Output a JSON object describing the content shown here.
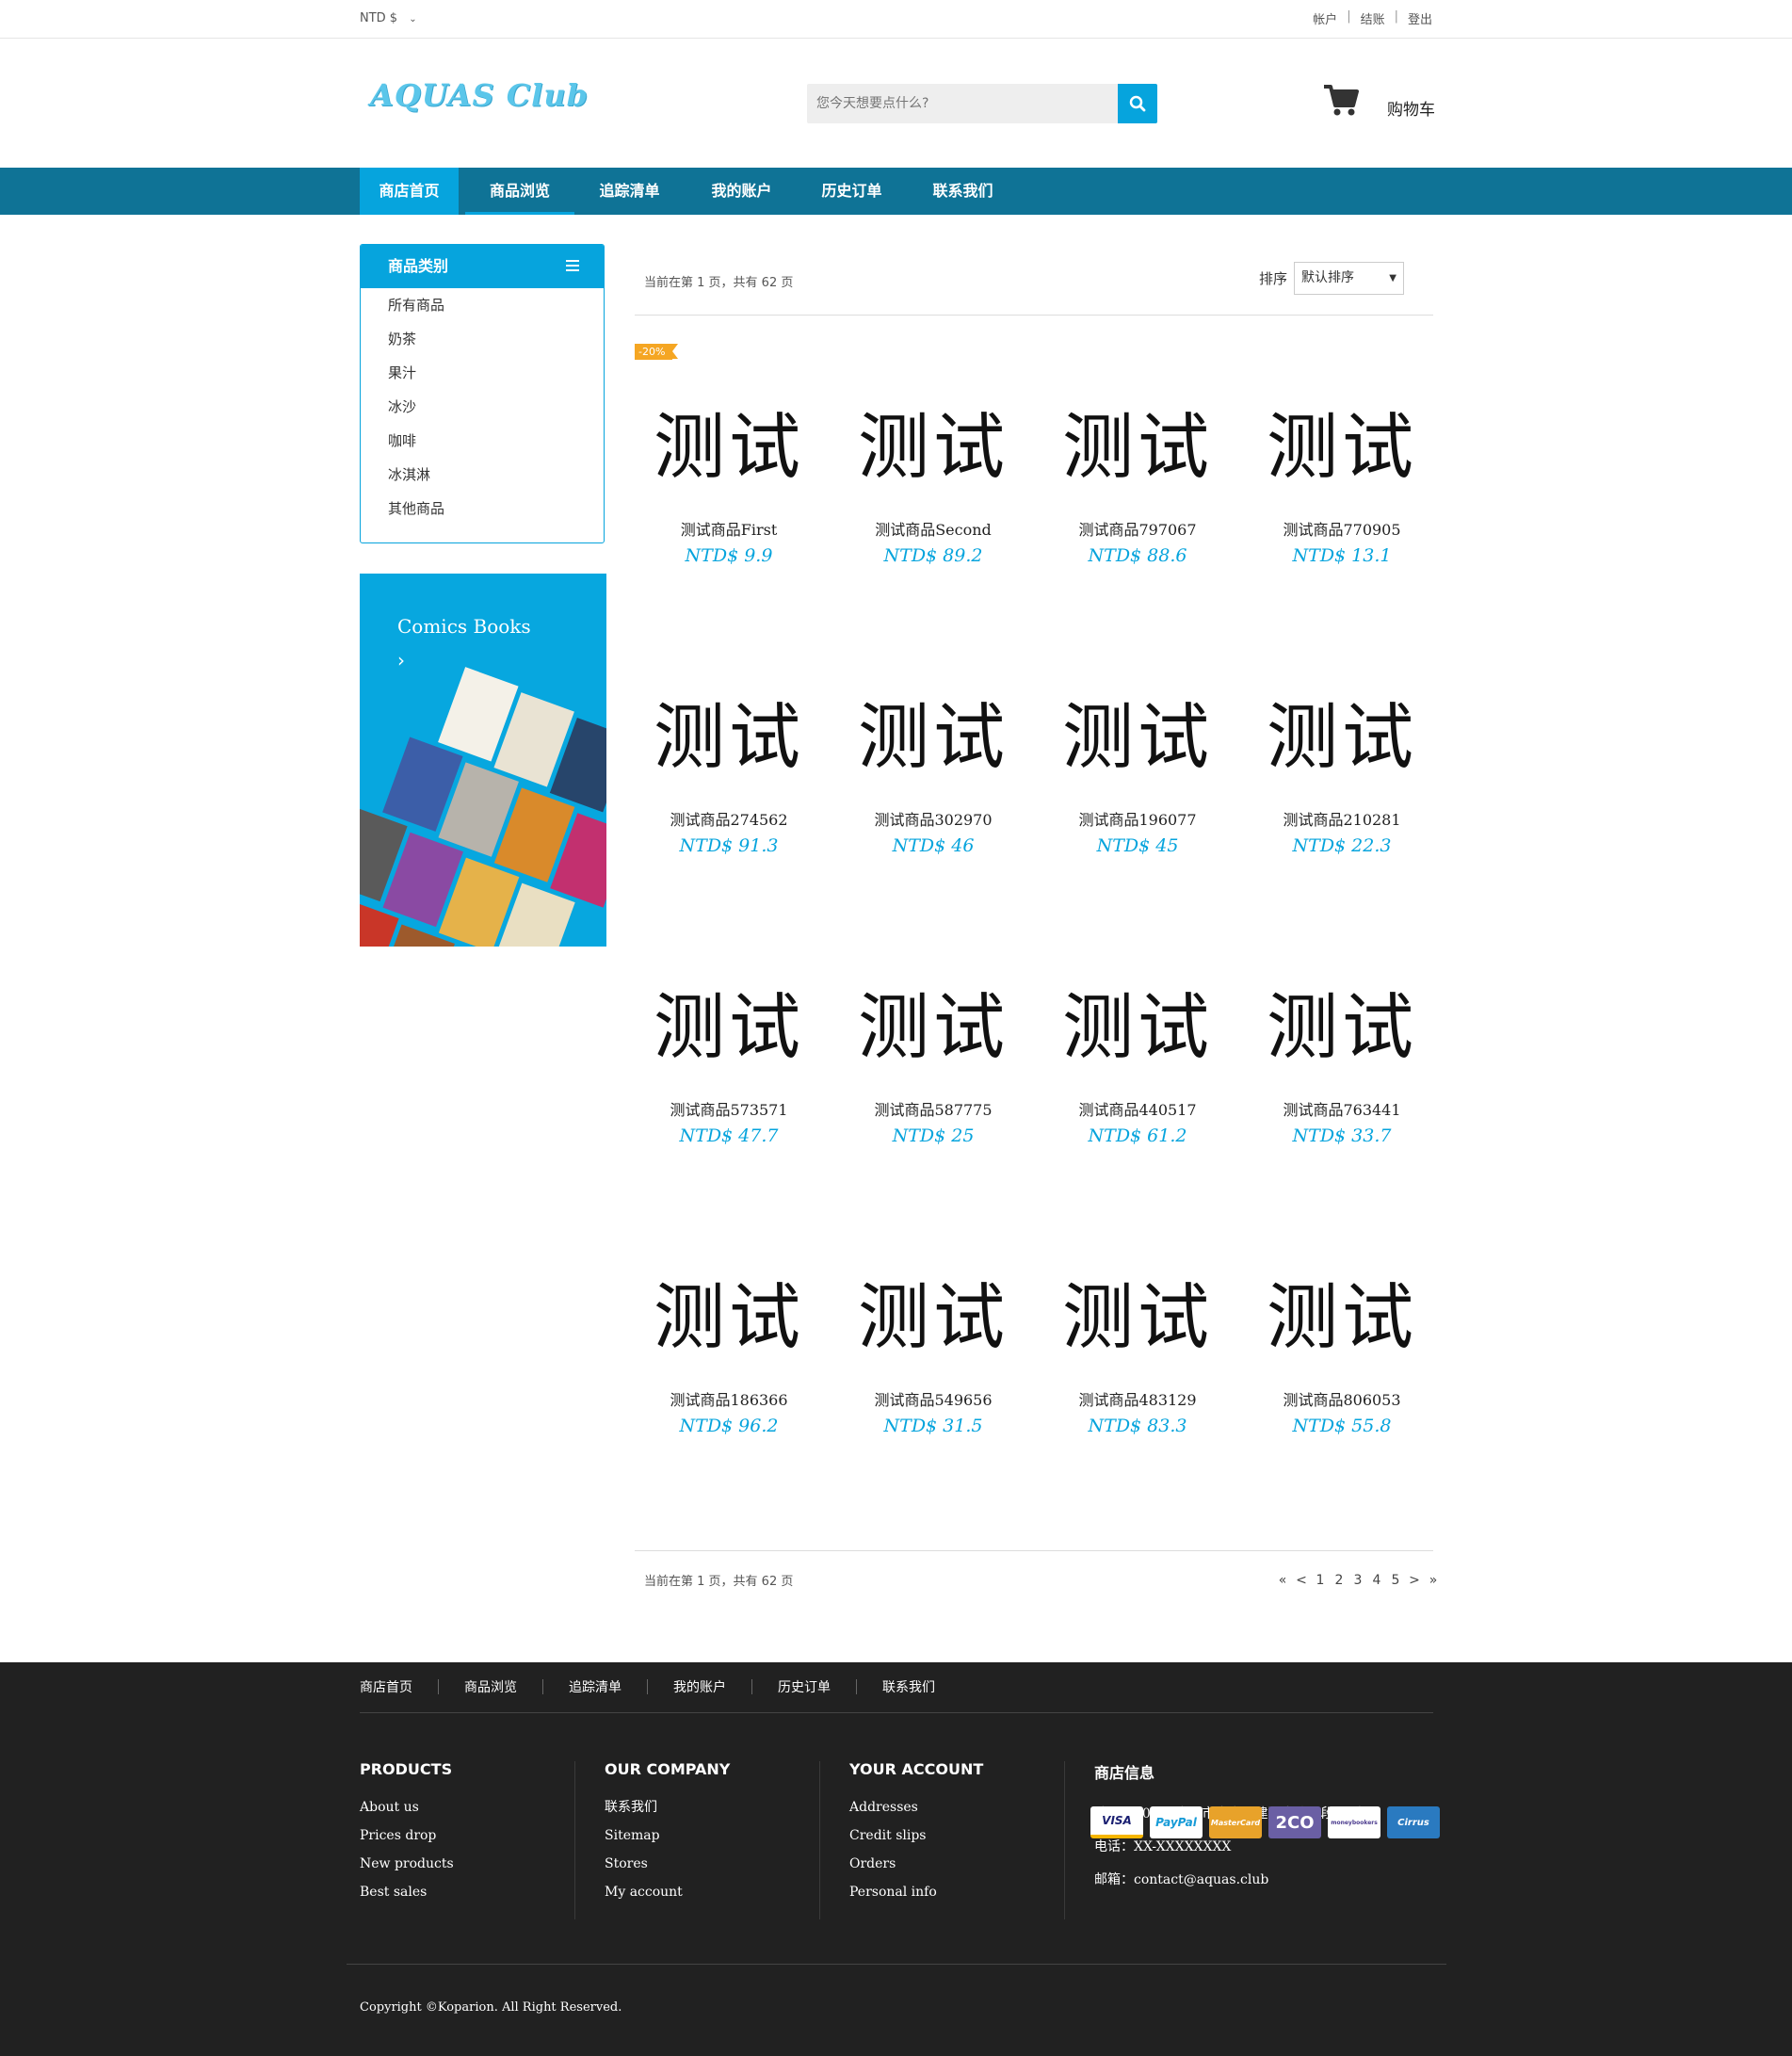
{
  "topbar": {
    "currency": "NTD $",
    "links": [
      "帐户",
      "结账",
      "登出"
    ]
  },
  "header": {
    "logo": "AQUAS Club",
    "search_placeholder": "您今天想要点什么?",
    "cart_label": "购物车"
  },
  "nav": {
    "items": [
      "商店首页",
      "商品浏览",
      "追踪清单",
      "我的账户",
      "历史订单",
      "联系我们"
    ]
  },
  "sidebar": {
    "categories_title": "商品类别",
    "categories": [
      "所有商品",
      "奶茶",
      "果汁",
      "冰沙",
      "咖啡",
      "冰淇淋",
      "其他商品"
    ],
    "banner_title": "Comics Books",
    "banner_arrow": "›"
  },
  "listing": {
    "page_info": "当前在第 1 页，共有 62 页",
    "sort_label": "排序",
    "sort_value": "默认排序",
    "discount_badge": "-20%",
    "products": [
      {
        "image_text": "测试",
        "name": "测试商品First",
        "price": "NTD$ 9.9"
      },
      {
        "image_text": "测试",
        "name": "测试商品Second",
        "price": "NTD$ 89.2"
      },
      {
        "image_text": "测试",
        "name": "测试商品797067",
        "price": "NTD$ 88.6"
      },
      {
        "image_text": "测试",
        "name": "测试商品770905",
        "price": "NTD$ 13.1"
      },
      {
        "image_text": "测试",
        "name": "测试商品274562",
        "price": "NTD$ 91.3"
      },
      {
        "image_text": "测试",
        "name": "测试商品302970",
        "price": "NTD$ 46"
      },
      {
        "image_text": "测试",
        "name": "测试商品196077",
        "price": "NTD$ 45"
      },
      {
        "image_text": "测试",
        "name": "测试商品210281",
        "price": "NTD$ 22.3"
      },
      {
        "image_text": "测试",
        "name": "测试商品573571",
        "price": "NTD$ 47.7"
      },
      {
        "image_text": "测试",
        "name": "测试商品587775",
        "price": "NTD$ 25"
      },
      {
        "image_text": "测试",
        "name": "测试商品440517",
        "price": "NTD$ 61.2"
      },
      {
        "image_text": "测试",
        "name": "测试商品763441",
        "price": "NTD$ 33.7"
      },
      {
        "image_text": "测试",
        "name": "测试商品186366",
        "price": "NTD$ 96.2"
      },
      {
        "image_text": "测试",
        "name": "测试商品549656",
        "price": "NTD$ 31.5"
      },
      {
        "image_text": "测试",
        "name": "测试商品483129",
        "price": "NTD$ 83.3"
      },
      {
        "image_text": "测试",
        "name": "测试商品806053",
        "price": "NTD$ 55.8"
      }
    ],
    "pager": [
      "«",
      "<",
      "1",
      "2",
      "3",
      "4",
      "5",
      ">",
      "»"
    ]
  },
  "footer": {
    "nav": [
      "商店首页",
      "商品浏览",
      "追踪清单",
      "我的账户",
      "历史订单",
      "联系我们"
    ],
    "columns": [
      {
        "title": "PRODUCTS",
        "items": [
          "About us",
          "Prices drop",
          "New products",
          "Best sales"
        ]
      },
      {
        "title": "OUR COMPANY",
        "items": [
          "联系我们",
          "Sitemap",
          "Stores",
          "My account"
        ]
      },
      {
        "title": "YOUR ACCOUNT",
        "items": [
          "Addresses",
          "Credit slips",
          "Orders",
          "Personal info"
        ]
      },
      {
        "title": "商店信息",
        "items": [
          "地址：10655臺北市大安區建國南路一段81號",
          "电话：XX-XXXXXXXX",
          "邮箱：contact@aquas.club"
        ]
      }
    ],
    "copyright": "Copyright ©Koparion. All Right Reserved.",
    "payments": [
      "VISA",
      "PayPal",
      "MasterCard",
      "2CO",
      "moneybookers",
      "Cirrus"
    ]
  },
  "colors": {
    "accent": "#06a4dd",
    "nav_bg": "#0f7396",
    "footer_bg": "#212121",
    "badge": "#f5a623"
  }
}
